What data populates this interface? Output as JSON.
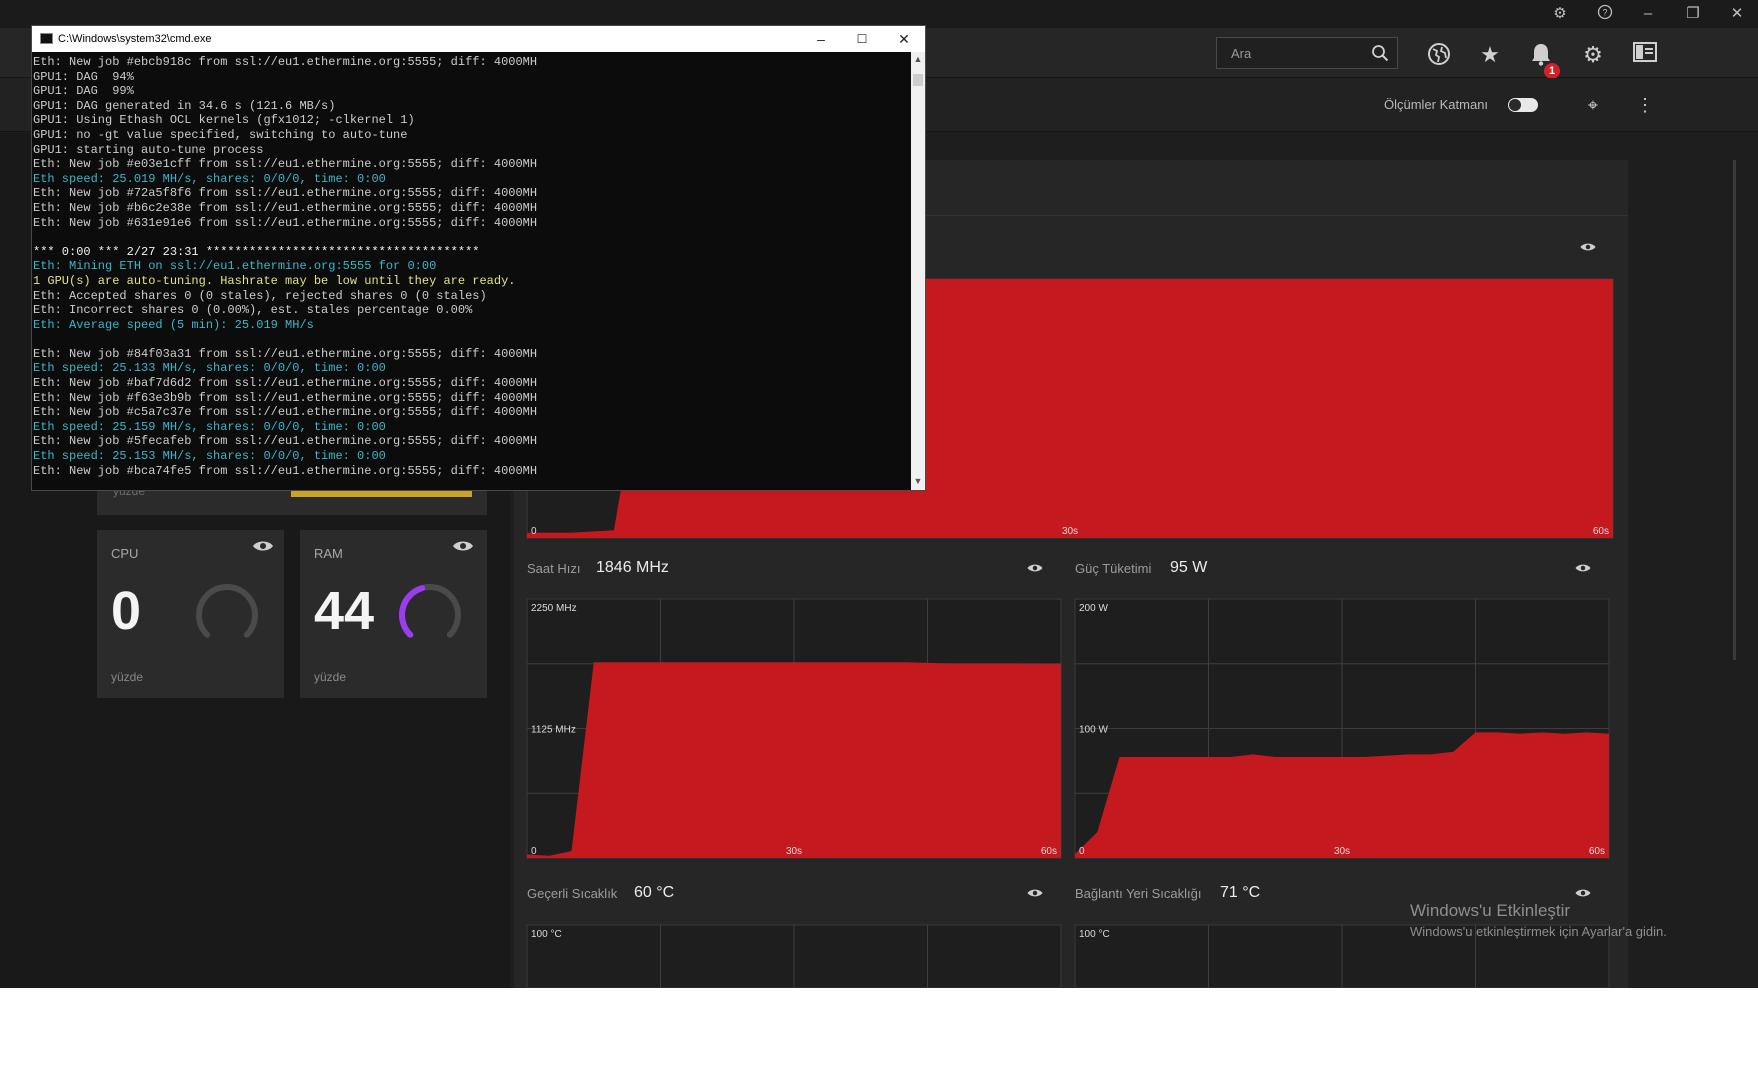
{
  "colors": {
    "accent": "#c8171e",
    "graph_fill": "#c41a1f",
    "graph_bg": "#1e1e1e",
    "grid": "#3e3e3e",
    "ram_ring": "#9b3cf0",
    "cmd_default": "#cccccc",
    "cmd_cyan": "#3ab7c8",
    "cmd_yellow": "#e5e08a"
  },
  "titlebar": {
    "icons": [
      "bug-icon",
      "help-icon",
      "minimize-icon",
      "restore-icon",
      "close-icon"
    ]
  },
  "toolbar": {
    "search_placeholder": "Ara",
    "notification_count": "1",
    "buttons": [
      "globe-icon",
      "star-icon",
      "bell-icon",
      "gear-icon",
      "sidebar-layout-icon"
    ]
  },
  "subbar": {
    "metrics_overlay_label": "Ölçümler Katmanı",
    "metrics_overlay_on": false
  },
  "cmd": {
    "title": "C:\\Windows\\system32\\cmd.exe",
    "lines": [
      {
        "t": "Eth: New job #ebcb918c from ssl://eu1.ethermine.org:5555; diff: 4000MH",
        "c": "d"
      },
      {
        "t": "GPU1: DAG  94%",
        "c": "d"
      },
      {
        "t": "GPU1: DAG  99%",
        "c": "d"
      },
      {
        "t": "GPU1: DAG generated in 34.6 s (121.6 MB/s)",
        "c": "d"
      },
      {
        "t": "GPU1: Using Ethash OCL kernels (gfx1012; -clkernel 1)",
        "c": "d"
      },
      {
        "t": "GPU1: no -gt value specified, switching to auto-tune",
        "c": "d"
      },
      {
        "t": "GPU1: starting auto-tune process",
        "c": "d"
      },
      {
        "t": "Eth: New job #e03e1cff from ssl://eu1.ethermine.org:5555; diff: 4000MH",
        "c": "d"
      },
      {
        "t": "Eth speed: 25.019 MH/s, shares: 0/0/0, time: 0:00",
        "c": "c"
      },
      {
        "t": "Eth: New job #72a5f8f6 from ssl://eu1.ethermine.org:5555; diff: 4000MH",
        "c": "d"
      },
      {
        "t": "Eth: New job #b6c2e38e from ssl://eu1.ethermine.org:5555; diff: 4000MH",
        "c": "d"
      },
      {
        "t": "Eth: New job #631e91e6 from ssl://eu1.ethermine.org:5555; diff: 4000MH",
        "c": "d"
      },
      {
        "t": "",
        "c": "d"
      },
      {
        "t": "*** 0:00 *** 2/27 23:31 **************************************",
        "c": "w"
      },
      {
        "t": "Eth: Mining ETH on ssl://eu1.ethermine.org:5555 for 0:00",
        "c": "c"
      },
      {
        "t": "1 GPU(s) are auto-tuning. Hashrate may be low until they are ready.",
        "c": "y"
      },
      {
        "t": "Eth: Accepted shares 0 (0 stales), rejected shares 0 (0 stales)",
        "c": "d"
      },
      {
        "t": "Eth: Incorrect shares 0 (0.00%), est. stales percentage 0.00%",
        "c": "d"
      },
      {
        "t": "Eth: Average speed (5 min): 25.019 MH/s",
        "c": "c"
      },
      {
        "t": "",
        "c": "d"
      },
      {
        "t": "Eth: New job #84f03a31 from ssl://eu1.ethermine.org:5555; diff: 4000MH",
        "c": "d"
      },
      {
        "t": "Eth speed: 25.133 MH/s, shares: 0/0/0, time: 0:00",
        "c": "c"
      },
      {
        "t": "Eth: New job #baf7d6d2 from ssl://eu1.ethermine.org:5555; diff: 4000MH",
        "c": "d"
      },
      {
        "t": "Eth: New job #f63e3b9b from ssl://eu1.ethermine.org:5555; diff: 4000MH",
        "c": "d"
      },
      {
        "t": "Eth: New job #c5a7c37e from ssl://eu1.ethermine.org:5555; diff: 4000MH",
        "c": "d"
      },
      {
        "t": "Eth speed: 25.159 MH/s, shares: 0/0/0, time: 0:00",
        "c": "c"
      },
      {
        "t": "Eth: New job #5fecafeb from ssl://eu1.ethermine.org:5555; diff: 4000MH",
        "c": "d"
      },
      {
        "t": "Eth speed: 25.153 MH/s, shares: 0/0/0, time: 0:00",
        "c": "c"
      },
      {
        "t": "Eth: New job #bca74fe5 from ssl://eu1.ethermine.org:5555; diff: 4000MH",
        "c": "d"
      }
    ]
  },
  "cards": {
    "top_card_unit": "yüzde",
    "cpu": {
      "title": "CPU",
      "value": "0",
      "unit": "yüzde",
      "percent": 0
    },
    "ram": {
      "title": "RAM",
      "value": "44",
      "unit": "yüzde",
      "percent": 44
    }
  },
  "graphs": {
    "gpu_load": {
      "y_min_label": "0",
      "x_labels": [
        "30s",
        "60s"
      ],
      "values": [
        2,
        2,
        3,
        100,
        100,
        100,
        100,
        100,
        100,
        100,
        100,
        100,
        100,
        100,
        100,
        100,
        100,
        100,
        100,
        100,
        100,
        100,
        100,
        100,
        100,
        100
      ]
    },
    "clock": {
      "label": "Saat Hızı",
      "value": "1846 MHz",
      "y_labels": [
        "2250 MHz",
        "1125 MHz",
        "0"
      ],
      "x_labels": [
        "30s",
        "60s"
      ],
      "max": 2250,
      "values": [
        30,
        20,
        60,
        1700,
        1700,
        1700,
        1700,
        1700,
        1700,
        1700,
        1700,
        1700,
        1700,
        1700,
        1700,
        1700,
        1700,
        1700,
        1695,
        1690,
        1690,
        1690,
        1690,
        1688,
        1688
      ]
    },
    "power": {
      "label": "Güç Tüketimi",
      "value": "95 W",
      "y_labels": [
        "200 W",
        "100 W",
        "0"
      ],
      "x_labels": [
        "30s",
        "60s"
      ],
      "max": 200,
      "values": [
        3,
        20,
        78,
        78,
        78,
        78,
        78,
        78,
        80,
        78,
        78,
        78,
        78,
        78,
        79,
        80,
        80,
        82,
        97,
        97,
        96,
        97,
        96,
        97,
        96
      ]
    },
    "temp": {
      "label": "Geçerli Sıcaklık",
      "value": "60 °C",
      "y_labels": [
        "100 °C"
      ]
    },
    "junction": {
      "label": "Bağlantı Yeri Sıcaklığı",
      "value": "71 °C",
      "y_labels": [
        "100 °C"
      ]
    }
  },
  "watermark": {
    "title": "Windows'u Etkinleştir",
    "subtitle": "Windows'u etkinleştirmek için Ayarlar'a gidin."
  }
}
